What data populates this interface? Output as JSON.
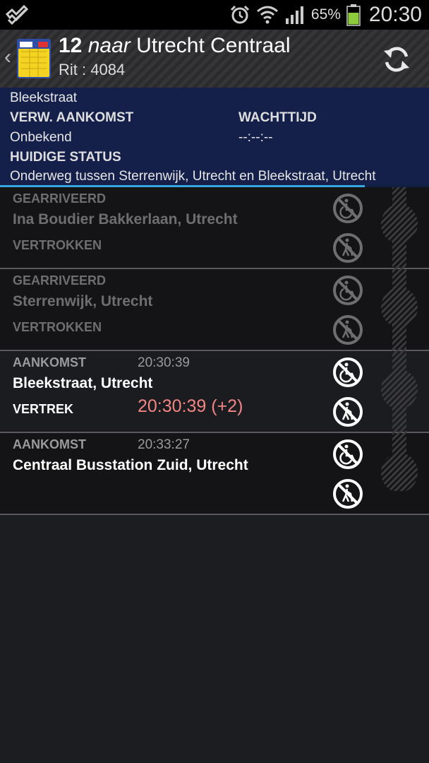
{
  "statusbar": {
    "battery_percent": "65%",
    "time": "20:30"
  },
  "header": {
    "route_number": "12",
    "direction_word": "naar",
    "destination": "Utrecht Centraal",
    "trip_label": "Rit : 4084"
  },
  "info": {
    "stop_name": "Bleekstraat",
    "expected_arrival_label": "VERW. AANKOMST",
    "expected_arrival_value": "Onbekend",
    "wait_time_label": "WACHTTIJD",
    "wait_time_value": "--:--:--",
    "status_label": "HUIDIGE STATUS",
    "status_value": "Onderweg tussen Sterrenwijk, Utrecht en Bleekstraat, Utrecht",
    "progress": 0.85
  },
  "stops": [
    {
      "top_label": "GEARRIVEERD",
      "top_time": "",
      "name": "Ina Boudier Bakkerlaan, Utrecht",
      "bottom_label": "VERTROKKEN",
      "bottom_time": ""
    },
    {
      "top_label": "GEARRIVEERD",
      "top_time": "",
      "name": "Sterrenwijk, Utrecht",
      "bottom_label": "VERTROKKEN",
      "bottom_time": ""
    },
    {
      "top_label": "AANKOMST",
      "top_time": "20:30:39",
      "name": "Bleekstraat, Utrecht",
      "bottom_label": "VERTREK",
      "bottom_time": "20:30:39  (+2)"
    },
    {
      "top_label": "AANKOMST",
      "top_time": "20:33:27",
      "name": "Centraal Busstation Zuid, Utrecht",
      "bottom_label": "",
      "bottom_time": ""
    }
  ],
  "icons": {
    "wheelchair": "no-wheelchair-icon",
    "walker": "no-walking-aid-icon"
  }
}
